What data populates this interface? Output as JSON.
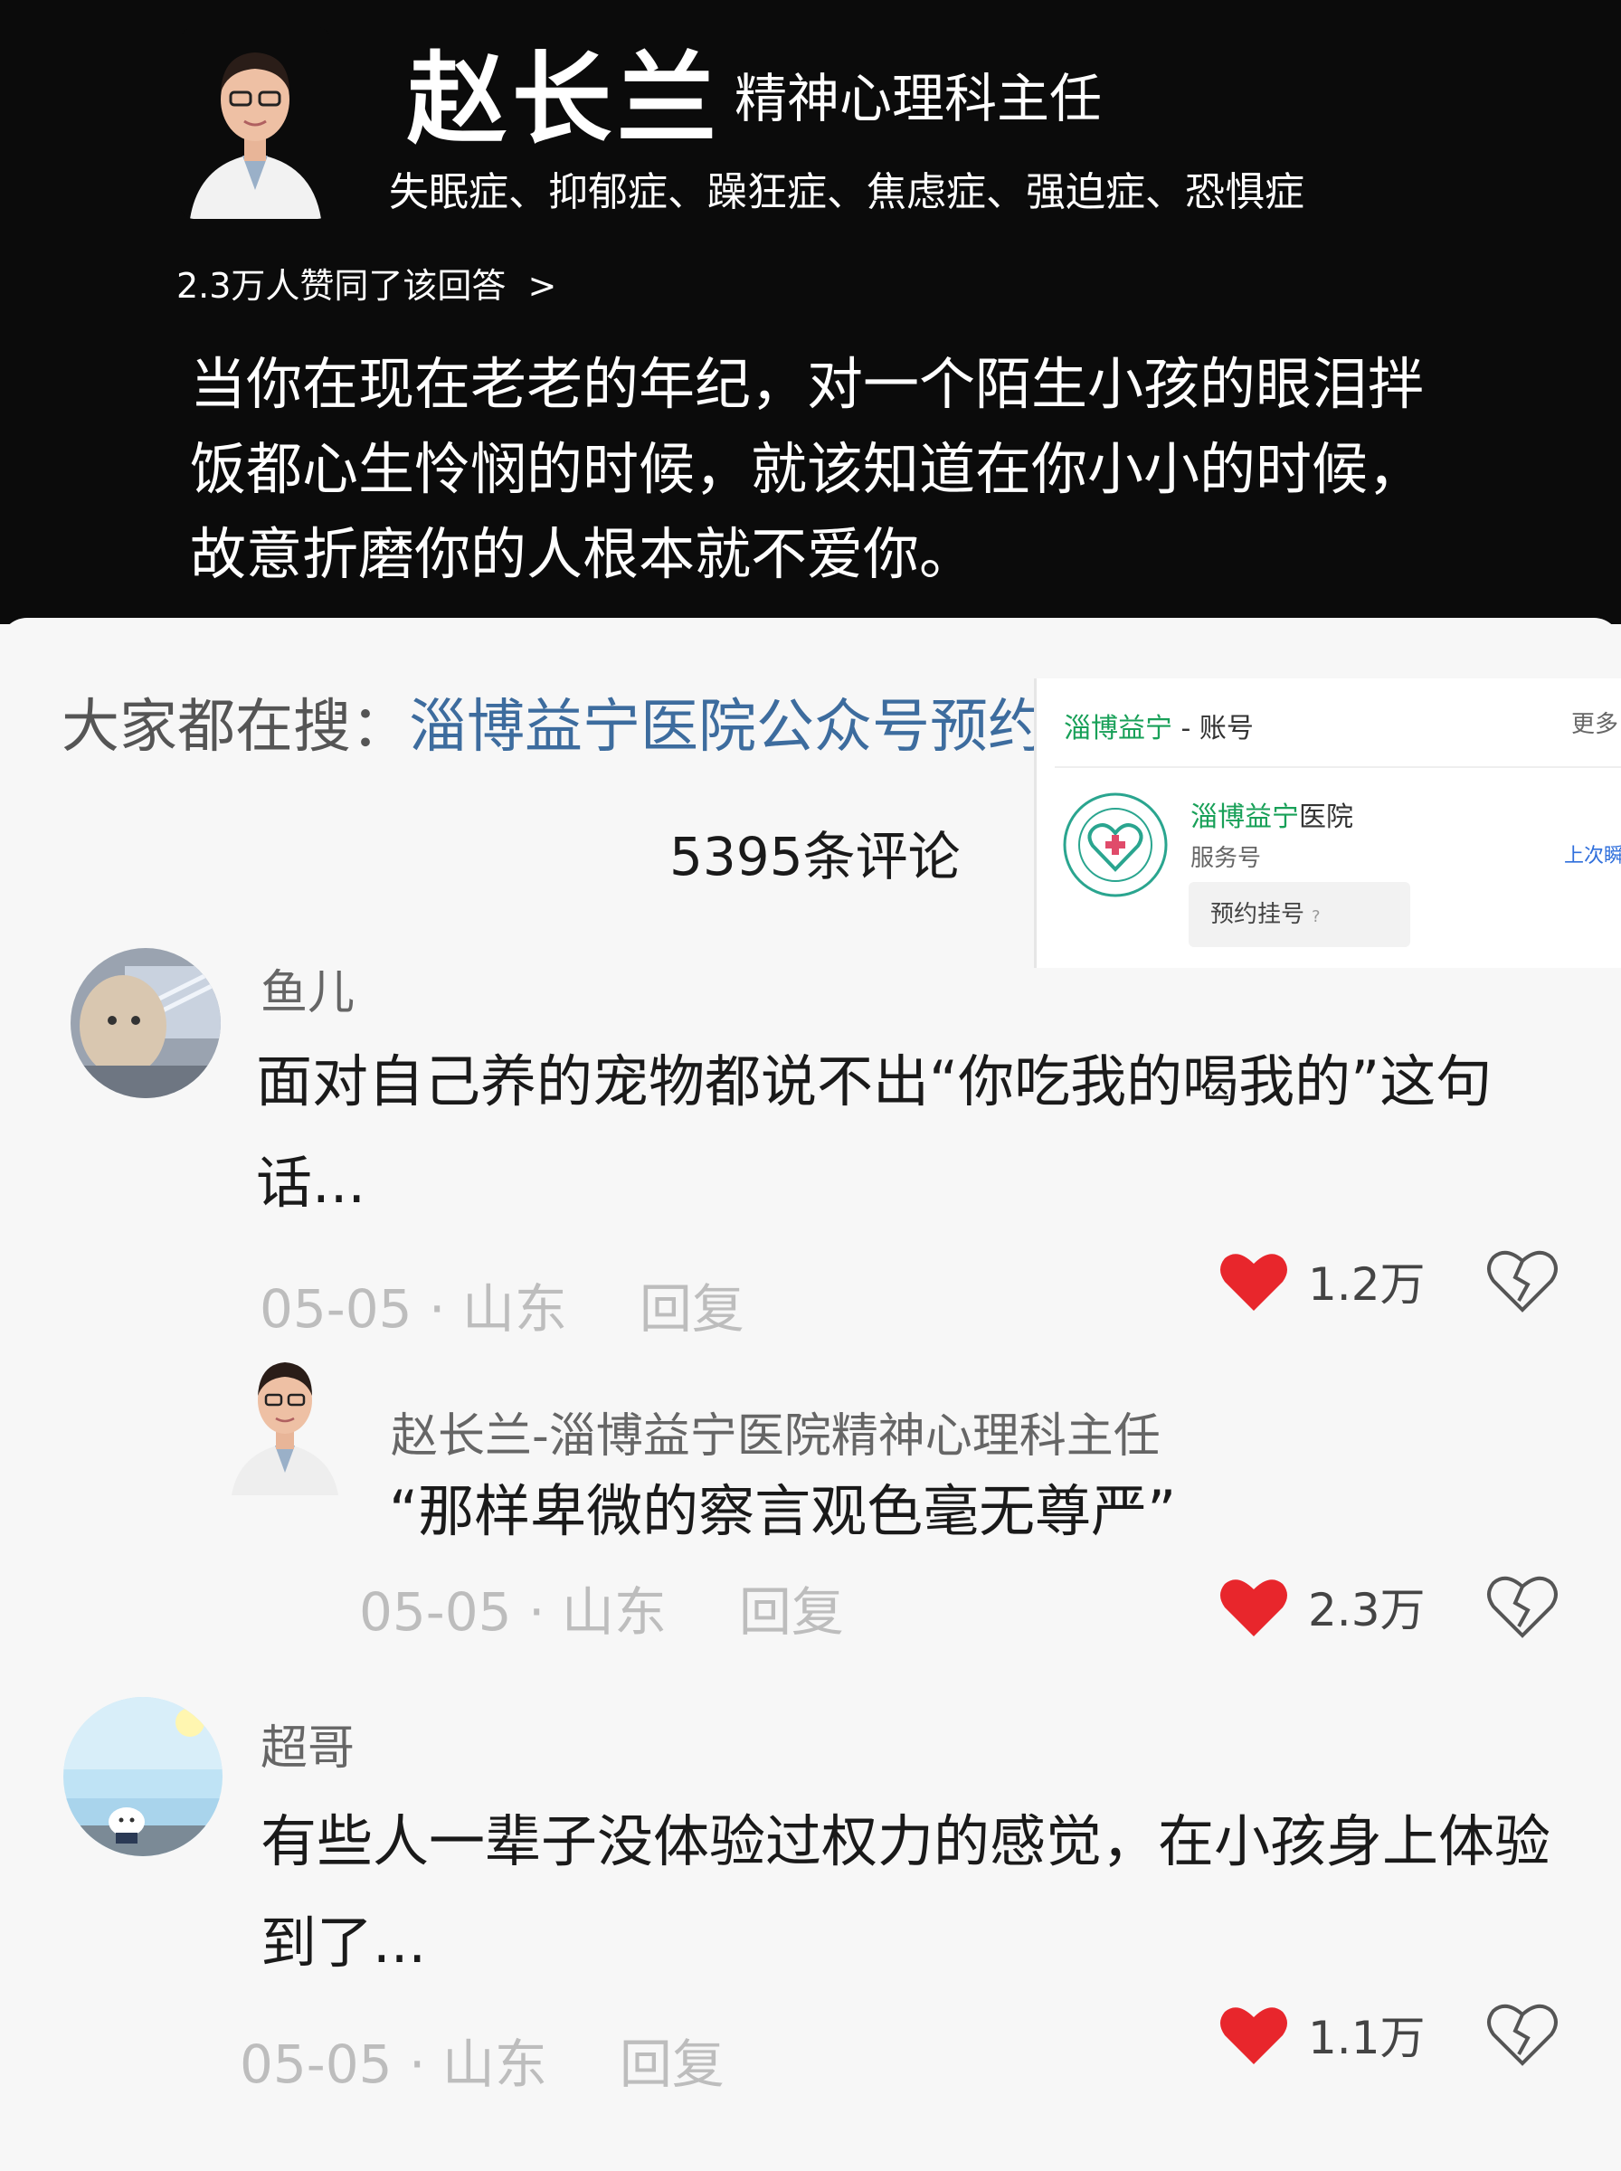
{
  "header": {
    "name": "赵长兰",
    "title": "精神心理科主任",
    "specialties": "失眠症、抑郁症、躁狂症、焦虑症、强迫症、恐惧症",
    "likes_text": "2.3万人赞同了该回答",
    "likes_chevron": ">",
    "quote": "当你在现在老老的年纪，对一个陌生小孩的眼泪拌饭都心生怜悯的时候，就该知道在你小小的时候，故意折磨你的人根本就不爱你。"
  },
  "search": {
    "prefix": "大家都在搜：",
    "keyword": "淄博益宁医院公众号预约"
  },
  "comments_count": "5395条评论",
  "account_card": {
    "head_green": "淄博益宁",
    "head_rest": " - 账号",
    "more": "更多",
    "name_green": "淄博益宁",
    "name_rest": "医院",
    "type": "服务号",
    "last": "上次瞬",
    "button": "预约挂号",
    "button_help": "?"
  },
  "comments": [
    {
      "user": "鱼儿",
      "text": "面对自己养的宠物都说不出“你吃我的喝我的”这句话...",
      "date": "05-05 · 山东",
      "reply": "回复",
      "likes": "1.2万"
    },
    {
      "user": "赵长兰-淄博益宁医院精神心理科主任",
      "text": "“那样卑微的察言观色毫无尊严”",
      "date": "05-05 · 山东",
      "reply": "回复",
      "likes": "2.3万"
    },
    {
      "user": "超哥",
      "text": "有些人一辈子没体验过权力的感觉，在小孩身上体验到了...",
      "date": "05-05 · 山东",
      "reply": "回复",
      "likes": "1.1万"
    }
  ],
  "colors": {
    "heart": "#e8262c",
    "link_blue": "#3d6c9e",
    "brand_green": "#18a058"
  }
}
